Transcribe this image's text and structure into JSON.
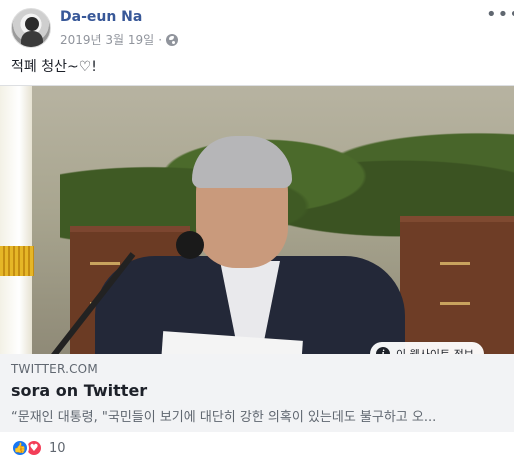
{
  "post": {
    "author": "Da-eun Na",
    "date": "2019년 3월 19일",
    "separator": "·",
    "privacy_icon": "globe-icon",
    "more_icon": "ellipsis-icon",
    "text": "적폐 청산~♡!"
  },
  "link_card": {
    "info_label": "이 웹사이트 정보",
    "domain": "TWITTER.COM",
    "title": "sora on Twitter",
    "description": "“문재인 대통령, \"국민들이 보기에 대단히 강한 의혹이 있는데도 불구하고 오..."
  },
  "reactions": {
    "icons": [
      "like-icon",
      "love-icon"
    ],
    "count": "10"
  },
  "colors": {
    "author": "#385898",
    "like": "#1877f2",
    "love": "#f33e58",
    "card_bg": "#f2f3f5"
  }
}
